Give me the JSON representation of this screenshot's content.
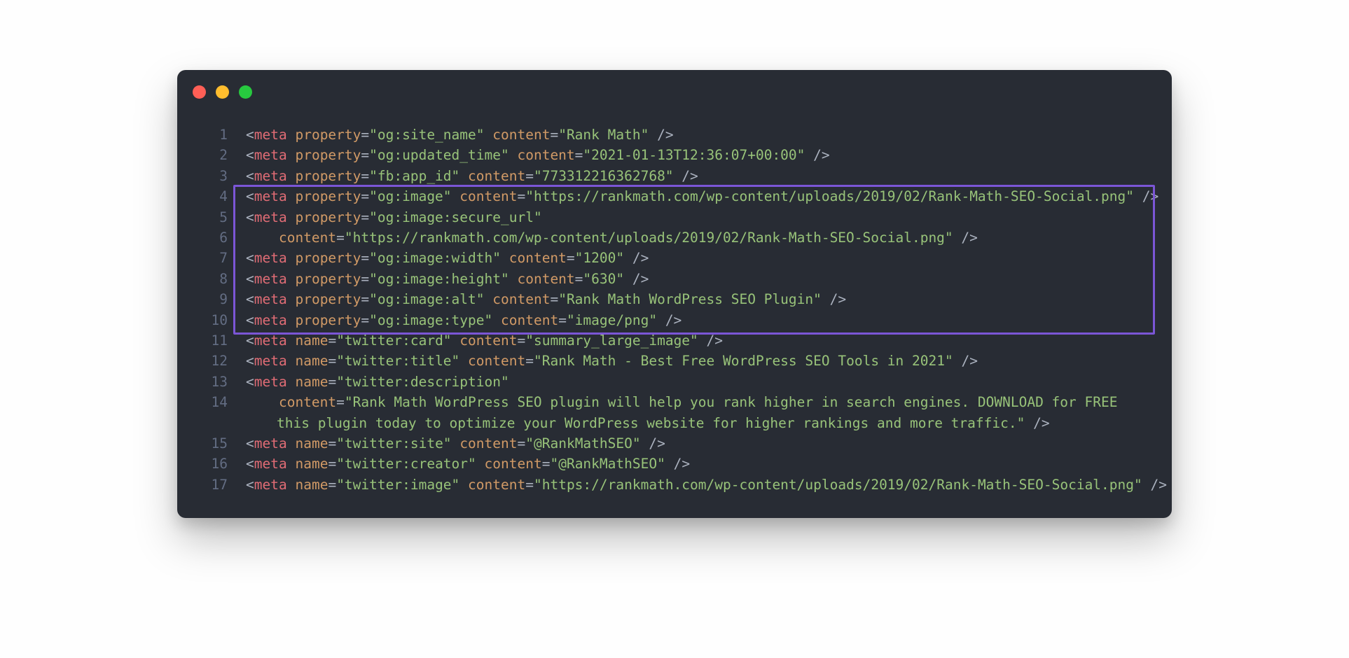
{
  "colors": {
    "bg": "#282c34",
    "gutter": "#636d83",
    "punct": "#abb2bf",
    "tag": "#e06c75",
    "attr": "#d19a66",
    "string": "#98c379",
    "highlight": "#7b56d6"
  },
  "traffic_lights": [
    "red",
    "yellow",
    "green"
  ],
  "highlight_lines": {
    "start": 4,
    "end": 10
  },
  "code_lines": [
    {
      "n": 1,
      "indent": 0,
      "tokens": [
        {
          "t": "punct",
          "v": "<"
        },
        {
          "t": "tag",
          "v": "meta"
        },
        {
          "t": "punct",
          "v": " "
        },
        {
          "t": "attr",
          "v": "property"
        },
        {
          "t": "punct",
          "v": "="
        },
        {
          "t": "str",
          "v": "\"og:site_name\""
        },
        {
          "t": "punct",
          "v": " "
        },
        {
          "t": "attr",
          "v": "content"
        },
        {
          "t": "punct",
          "v": "="
        },
        {
          "t": "str",
          "v": "\"Rank Math\""
        },
        {
          "t": "punct",
          "v": " />"
        }
      ]
    },
    {
      "n": 2,
      "indent": 0,
      "tokens": [
        {
          "t": "punct",
          "v": "<"
        },
        {
          "t": "tag",
          "v": "meta"
        },
        {
          "t": "punct",
          "v": " "
        },
        {
          "t": "attr",
          "v": "property"
        },
        {
          "t": "punct",
          "v": "="
        },
        {
          "t": "str",
          "v": "\"og:updated_time\""
        },
        {
          "t": "punct",
          "v": " "
        },
        {
          "t": "attr",
          "v": "content"
        },
        {
          "t": "punct",
          "v": "="
        },
        {
          "t": "str",
          "v": "\"2021-01-13T12:36:07+00:00\""
        },
        {
          "t": "punct",
          "v": " />"
        }
      ]
    },
    {
      "n": 3,
      "indent": 0,
      "tokens": [
        {
          "t": "punct",
          "v": "<"
        },
        {
          "t": "tag",
          "v": "meta"
        },
        {
          "t": "punct",
          "v": " "
        },
        {
          "t": "attr",
          "v": "property"
        },
        {
          "t": "punct",
          "v": "="
        },
        {
          "t": "str",
          "v": "\"fb:app_id\""
        },
        {
          "t": "punct",
          "v": " "
        },
        {
          "t": "attr",
          "v": "content"
        },
        {
          "t": "punct",
          "v": "="
        },
        {
          "t": "str",
          "v": "\"773312216362768\""
        },
        {
          "t": "punct",
          "v": " />"
        }
      ]
    },
    {
      "n": 4,
      "indent": 0,
      "tokens": [
        {
          "t": "punct",
          "v": "<"
        },
        {
          "t": "tag",
          "v": "meta"
        },
        {
          "t": "punct",
          "v": " "
        },
        {
          "t": "attr",
          "v": "property"
        },
        {
          "t": "punct",
          "v": "="
        },
        {
          "t": "str",
          "v": "\"og:image\""
        },
        {
          "t": "punct",
          "v": " "
        },
        {
          "t": "attr",
          "v": "content"
        },
        {
          "t": "punct",
          "v": "="
        },
        {
          "t": "str",
          "v": "\"https://rankmath.com/wp-content/uploads/2019/02/Rank-Math-SEO-Social.png\""
        },
        {
          "t": "punct",
          "v": " />"
        }
      ]
    },
    {
      "n": 5,
      "indent": 0,
      "tokens": [
        {
          "t": "punct",
          "v": "<"
        },
        {
          "t": "tag",
          "v": "meta"
        },
        {
          "t": "punct",
          "v": " "
        },
        {
          "t": "attr",
          "v": "property"
        },
        {
          "t": "punct",
          "v": "="
        },
        {
          "t": "str",
          "v": "\"og:image:secure_url\""
        }
      ]
    },
    {
      "n": 6,
      "indent": 4,
      "tokens": [
        {
          "t": "attr",
          "v": "content"
        },
        {
          "t": "punct",
          "v": "="
        },
        {
          "t": "str",
          "v": "\"https://rankmath.com/wp-content/uploads/2019/02/Rank-Math-SEO-Social.png\""
        },
        {
          "t": "punct",
          "v": " />"
        }
      ]
    },
    {
      "n": 7,
      "indent": 0,
      "tokens": [
        {
          "t": "punct",
          "v": "<"
        },
        {
          "t": "tag",
          "v": "meta"
        },
        {
          "t": "punct",
          "v": " "
        },
        {
          "t": "attr",
          "v": "property"
        },
        {
          "t": "punct",
          "v": "="
        },
        {
          "t": "str",
          "v": "\"og:image:width\""
        },
        {
          "t": "punct",
          "v": " "
        },
        {
          "t": "attr",
          "v": "content"
        },
        {
          "t": "punct",
          "v": "="
        },
        {
          "t": "str",
          "v": "\"1200\""
        },
        {
          "t": "punct",
          "v": " />"
        }
      ]
    },
    {
      "n": 8,
      "indent": 0,
      "tokens": [
        {
          "t": "punct",
          "v": "<"
        },
        {
          "t": "tag",
          "v": "meta"
        },
        {
          "t": "punct",
          "v": " "
        },
        {
          "t": "attr",
          "v": "property"
        },
        {
          "t": "punct",
          "v": "="
        },
        {
          "t": "str",
          "v": "\"og:image:height\""
        },
        {
          "t": "punct",
          "v": " "
        },
        {
          "t": "attr",
          "v": "content"
        },
        {
          "t": "punct",
          "v": "="
        },
        {
          "t": "str",
          "v": "\"630\""
        },
        {
          "t": "punct",
          "v": " />"
        }
      ]
    },
    {
      "n": 9,
      "indent": 0,
      "tokens": [
        {
          "t": "punct",
          "v": "<"
        },
        {
          "t": "tag",
          "v": "meta"
        },
        {
          "t": "punct",
          "v": " "
        },
        {
          "t": "attr",
          "v": "property"
        },
        {
          "t": "punct",
          "v": "="
        },
        {
          "t": "str",
          "v": "\"og:image:alt\""
        },
        {
          "t": "punct",
          "v": " "
        },
        {
          "t": "attr",
          "v": "content"
        },
        {
          "t": "punct",
          "v": "="
        },
        {
          "t": "str",
          "v": "\"Rank Math WordPress SEO Plugin\""
        },
        {
          "t": "punct",
          "v": " />"
        }
      ]
    },
    {
      "n": 10,
      "indent": 0,
      "tokens": [
        {
          "t": "punct",
          "v": "<"
        },
        {
          "t": "tag",
          "v": "meta"
        },
        {
          "t": "punct",
          "v": " "
        },
        {
          "t": "attr",
          "v": "property"
        },
        {
          "t": "punct",
          "v": "="
        },
        {
          "t": "str",
          "v": "\"og:image:type\""
        },
        {
          "t": "punct",
          "v": " "
        },
        {
          "t": "attr",
          "v": "content"
        },
        {
          "t": "punct",
          "v": "="
        },
        {
          "t": "str",
          "v": "\"image/png\""
        },
        {
          "t": "punct",
          "v": " />"
        }
      ]
    },
    {
      "n": 11,
      "indent": 0,
      "tokens": [
        {
          "t": "punct",
          "v": "<"
        },
        {
          "t": "tag",
          "v": "meta"
        },
        {
          "t": "punct",
          "v": " "
        },
        {
          "t": "attr",
          "v": "name"
        },
        {
          "t": "punct",
          "v": "="
        },
        {
          "t": "str",
          "v": "\"twitter:card\""
        },
        {
          "t": "punct",
          "v": " "
        },
        {
          "t": "attr",
          "v": "content"
        },
        {
          "t": "punct",
          "v": "="
        },
        {
          "t": "str",
          "v": "\"summary_large_image\""
        },
        {
          "t": "punct",
          "v": " />"
        }
      ]
    },
    {
      "n": 12,
      "indent": 0,
      "tokens": [
        {
          "t": "punct",
          "v": "<"
        },
        {
          "t": "tag",
          "v": "meta"
        },
        {
          "t": "punct",
          "v": " "
        },
        {
          "t": "attr",
          "v": "name"
        },
        {
          "t": "punct",
          "v": "="
        },
        {
          "t": "str",
          "v": "\"twitter:title\""
        },
        {
          "t": "punct",
          "v": " "
        },
        {
          "t": "attr",
          "v": "content"
        },
        {
          "t": "punct",
          "v": "="
        },
        {
          "t": "str",
          "v": "\"Rank Math - Best Free WordPress SEO Tools in 2021\""
        },
        {
          "t": "punct",
          "v": " />"
        }
      ]
    },
    {
      "n": 13,
      "indent": 0,
      "tokens": [
        {
          "t": "punct",
          "v": "<"
        },
        {
          "t": "tag",
          "v": "meta"
        },
        {
          "t": "punct",
          "v": " "
        },
        {
          "t": "attr",
          "v": "name"
        },
        {
          "t": "punct",
          "v": "="
        },
        {
          "t": "str",
          "v": "\"twitter:description\""
        }
      ]
    },
    {
      "n": 14,
      "indent": 4,
      "wrap": true,
      "tokens": [
        {
          "t": "attr",
          "v": "content"
        },
        {
          "t": "punct",
          "v": "="
        },
        {
          "t": "str",
          "v": "\"Rank Math WordPress SEO plugin will help you rank higher in search engines. DOWNLOAD for FREE this plugin today to optimize your WordPress website for higher rankings and more traffic.\""
        },
        {
          "t": "punct",
          "v": " />"
        }
      ]
    },
    {
      "n": 15,
      "indent": 0,
      "tokens": [
        {
          "t": "punct",
          "v": "<"
        },
        {
          "t": "tag",
          "v": "meta"
        },
        {
          "t": "punct",
          "v": " "
        },
        {
          "t": "attr",
          "v": "name"
        },
        {
          "t": "punct",
          "v": "="
        },
        {
          "t": "str",
          "v": "\"twitter:site\""
        },
        {
          "t": "punct",
          "v": " "
        },
        {
          "t": "attr",
          "v": "content"
        },
        {
          "t": "punct",
          "v": "="
        },
        {
          "t": "str",
          "v": "\"@RankMathSEO\""
        },
        {
          "t": "punct",
          "v": " />"
        }
      ]
    },
    {
      "n": 16,
      "indent": 0,
      "tokens": [
        {
          "t": "punct",
          "v": "<"
        },
        {
          "t": "tag",
          "v": "meta"
        },
        {
          "t": "punct",
          "v": " "
        },
        {
          "t": "attr",
          "v": "name"
        },
        {
          "t": "punct",
          "v": "="
        },
        {
          "t": "str",
          "v": "\"twitter:creator\""
        },
        {
          "t": "punct",
          "v": " "
        },
        {
          "t": "attr",
          "v": "content"
        },
        {
          "t": "punct",
          "v": "="
        },
        {
          "t": "str",
          "v": "\"@RankMathSEO\""
        },
        {
          "t": "punct",
          "v": " />"
        }
      ]
    },
    {
      "n": 17,
      "indent": 0,
      "tokens": [
        {
          "t": "punct",
          "v": "<"
        },
        {
          "t": "tag",
          "v": "meta"
        },
        {
          "t": "punct",
          "v": " "
        },
        {
          "t": "attr",
          "v": "name"
        },
        {
          "t": "punct",
          "v": "="
        },
        {
          "t": "str",
          "v": "\"twitter:image\""
        },
        {
          "t": "punct",
          "v": " "
        },
        {
          "t": "attr",
          "v": "content"
        },
        {
          "t": "punct",
          "v": "="
        },
        {
          "t": "str",
          "v": "\"https://rankmath.com/wp-content/uploads/2019/02/Rank-Math-SEO-Social.png\""
        },
        {
          "t": "punct",
          "v": " />"
        }
      ]
    }
  ]
}
